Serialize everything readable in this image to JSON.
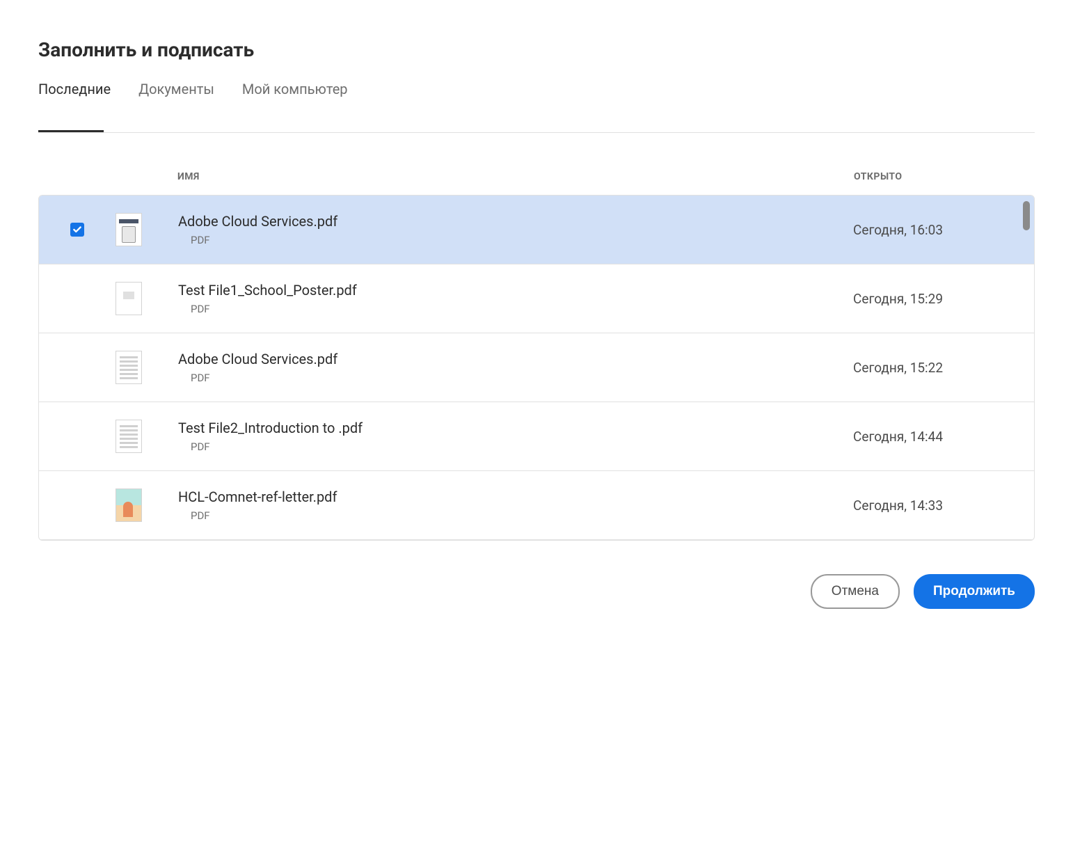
{
  "dialog": {
    "title": "Заполнить и подписать"
  },
  "tabs": {
    "items": [
      {
        "label": "Последние",
        "active": true
      },
      {
        "label": "Документы",
        "active": false
      },
      {
        "label": "Мой компьютер",
        "active": false
      }
    ]
  },
  "columns": {
    "name": "ИМЯ",
    "opened": "ОТКРЫТО"
  },
  "files": [
    {
      "name": "Adobe Cloud Services.pdf",
      "type": "PDF",
      "opened": "Сегодня, 16:03",
      "selected": true,
      "thumb": "acs"
    },
    {
      "name": "Test File1_School_Poster.pdf",
      "type": "PDF",
      "opened": "Сегодня, 15:29",
      "selected": false,
      "thumb": "placeholder"
    },
    {
      "name": "Adobe Cloud Services.pdf",
      "type": "PDF",
      "opened": "Сегодня, 15:22",
      "selected": false,
      "thumb": "textlines"
    },
    {
      "name": "Test File2_Introduction to  .pdf",
      "type": "PDF",
      "opened": "Сегодня, 14:44",
      "selected": false,
      "thumb": "textlines"
    },
    {
      "name": "HCL-Comnet-ref-letter.pdf",
      "type": "PDF",
      "opened": "Сегодня, 14:33",
      "selected": false,
      "thumb": "colorful"
    }
  ],
  "footer": {
    "cancel": "Отмена",
    "continue": "Продолжить"
  }
}
